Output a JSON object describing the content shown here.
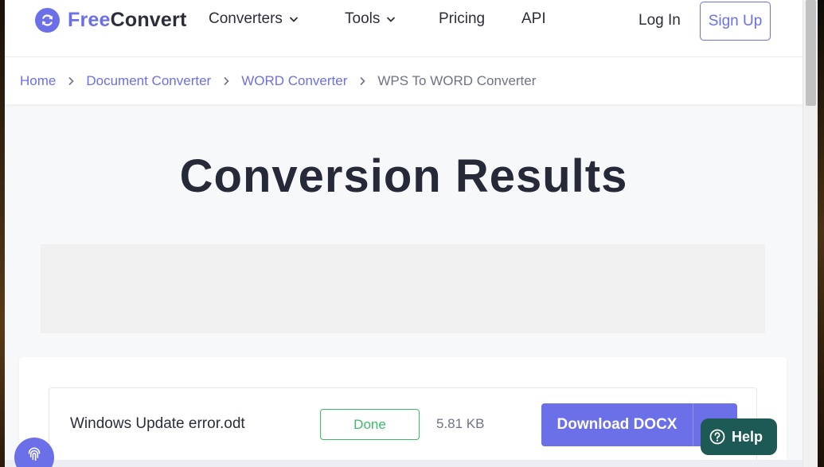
{
  "brand": {
    "name_part1": "Free",
    "name_part2": "Convert",
    "accent": "#6b6fe8"
  },
  "nav": {
    "converters": "Converters",
    "tools": "Tools",
    "pricing": "Pricing",
    "api": "API",
    "login": "Log In",
    "signup": "Sign Up"
  },
  "breadcrumb": [
    "Home",
    "Document Converter",
    "WORD Converter",
    "WPS To WORD Converter"
  ],
  "page": {
    "title": "Conversion Results"
  },
  "result": {
    "file_name": "Windows Update error.odt",
    "status": "Done",
    "status_color": "#3dbb6a",
    "size": "5.81 KB",
    "download_label": "Download DOCX"
  },
  "help": {
    "label": "Help",
    "color": "#1d5a55"
  },
  "icons": {
    "logo": "refresh-circle-icon",
    "dropdown": "chevron-down-icon",
    "separator": "chevron-right-icon",
    "download_menu": "chevron-down-icon",
    "help": "question-circle-icon",
    "fingerprint": "fingerprint-icon"
  }
}
